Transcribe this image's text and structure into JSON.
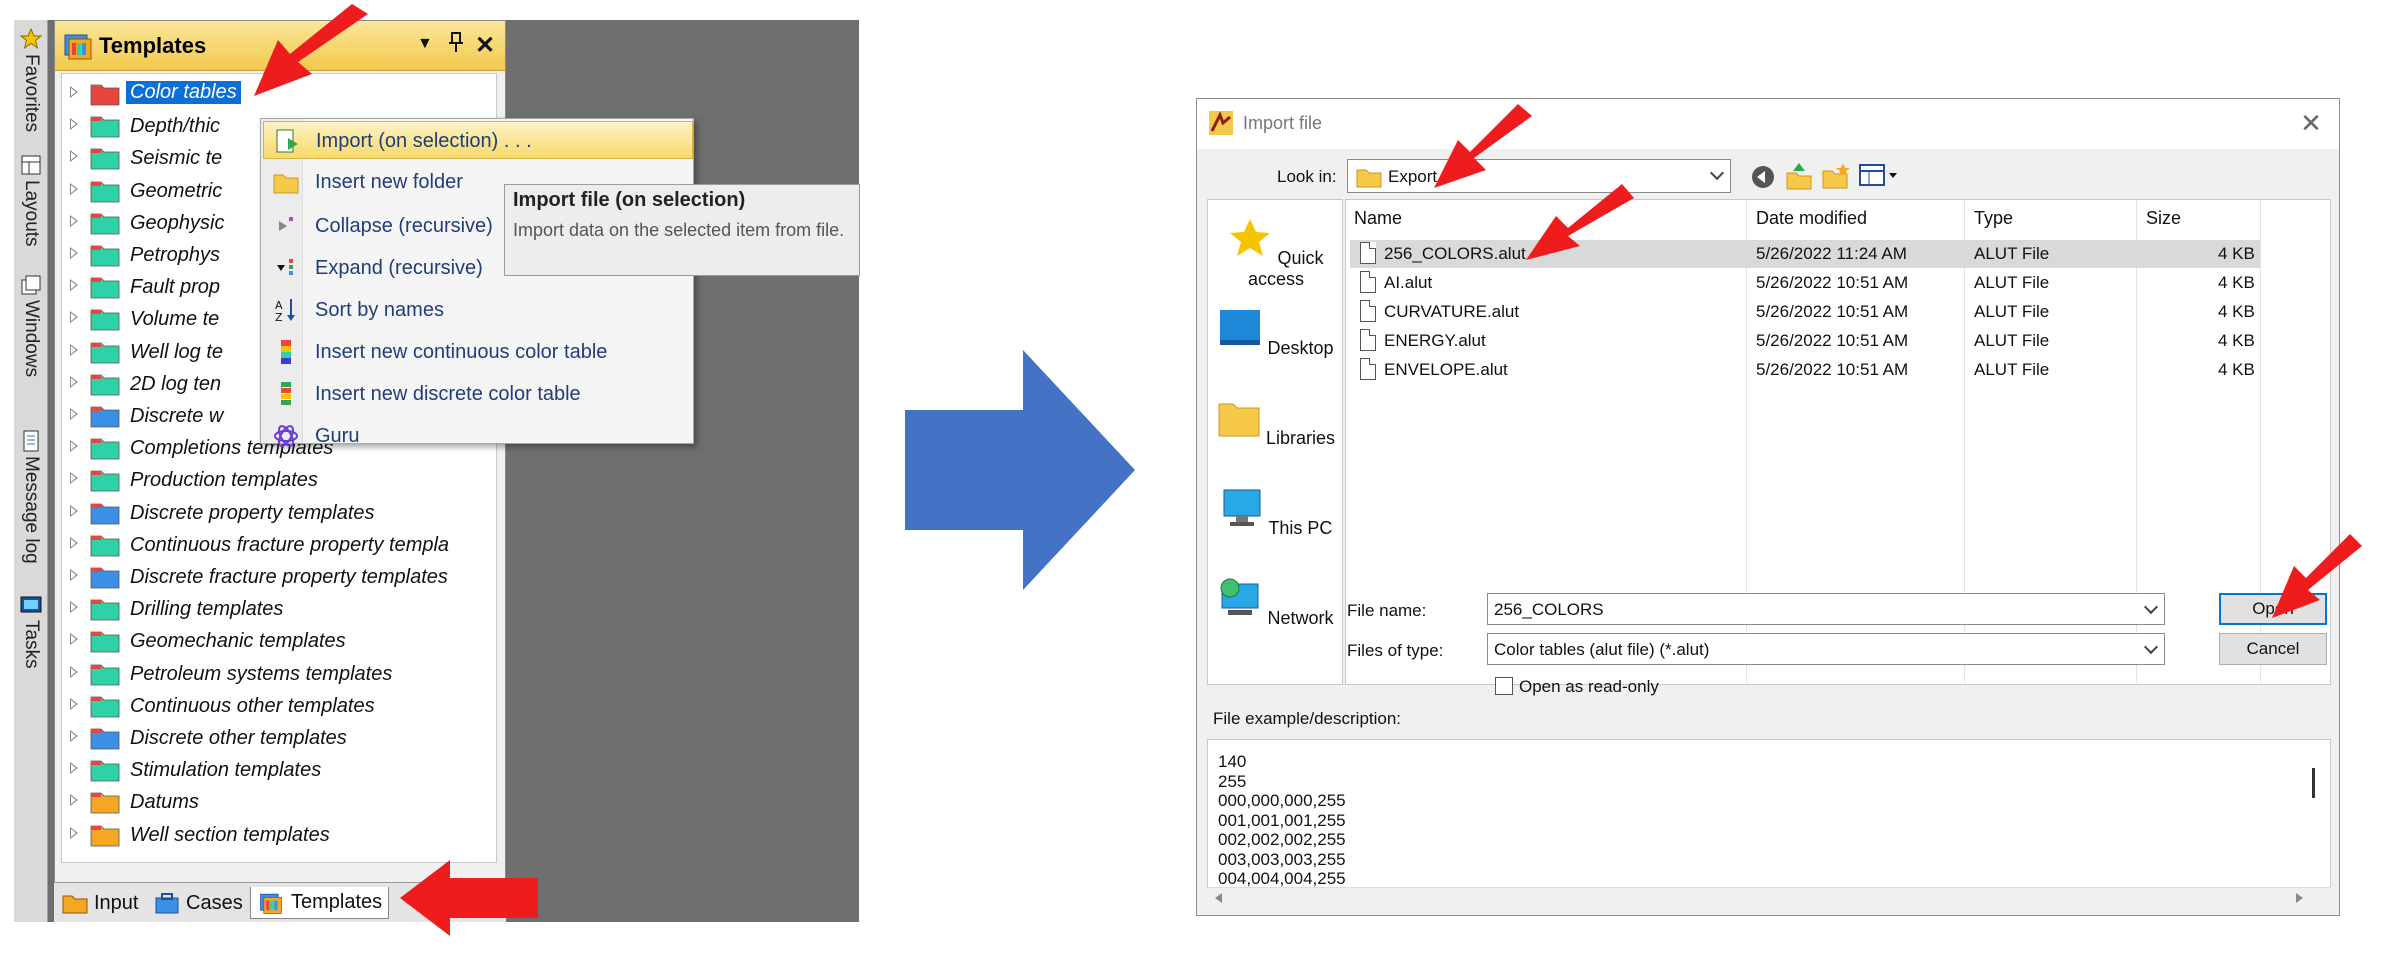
{
  "left_panel": {
    "vertical_tabs": [
      {
        "label": "Favorites",
        "icon": "star-icon"
      },
      {
        "label": "Layouts",
        "icon": "layout-icon"
      },
      {
        "label": "Windows",
        "icon": "windows-icon"
      },
      {
        "label": "Message log",
        "icon": "message-log-icon"
      },
      {
        "label": "Tasks",
        "icon": "tasks-icon"
      }
    ],
    "pane": {
      "title": "Templates",
      "controls": [
        "▼",
        "📌",
        "✕"
      ]
    },
    "tree_items": [
      {
        "label": "Color tables",
        "selected": true,
        "folder_color": "#e8453c"
      },
      {
        "label": "Depth/thic",
        "folder_color": "#2fd1a6"
      },
      {
        "label": "Seismic te",
        "folder_color": "#2fd1a6"
      },
      {
        "label": "Geometric",
        "folder_color": "#2fd1a6"
      },
      {
        "label": "Geophysic",
        "folder_color": "#2fd1a6"
      },
      {
        "label": "Petrophys",
        "folder_color": "#2fd1a6"
      },
      {
        "label": "Fault prop",
        "folder_color": "#2fd1a6"
      },
      {
        "label": "Volume te",
        "folder_color": "#2fd1a6"
      },
      {
        "label": "Well log te",
        "folder_color": "#2fd1a6"
      },
      {
        "label": "2D log ten",
        "folder_color": "#2fd1a6"
      },
      {
        "label": "Discrete w",
        "folder_color": "#3b8fe6"
      },
      {
        "label": "Completions templates",
        "folder_color": "#2fd1a6"
      },
      {
        "label": "Production templates",
        "folder_color": "#2fd1a6"
      },
      {
        "label": "Discrete property templates",
        "folder_color": "#3b8fe6"
      },
      {
        "label": "Continuous fracture property templa",
        "folder_color": "#2fd1a6"
      },
      {
        "label": "Discrete fracture property templates",
        "folder_color": "#3b8fe6"
      },
      {
        "label": "Drilling templates",
        "folder_color": "#2fd1a6"
      },
      {
        "label": "Geomechanic templates",
        "folder_color": "#2fd1a6"
      },
      {
        "label": "Petroleum systems templates",
        "folder_color": "#2fd1a6"
      },
      {
        "label": "Continuous other templates",
        "folder_color": "#2fd1a6"
      },
      {
        "label": "Discrete other templates",
        "folder_color": "#3b8fe6"
      },
      {
        "label": "Stimulation templates",
        "folder_color": "#2fd1a6"
      },
      {
        "label": "Datums",
        "folder_color": "#f5a623"
      },
      {
        "label": "Well section templates",
        "folder_color": "#f5a623"
      }
    ],
    "bottom_tabs": [
      {
        "label": "Input"
      },
      {
        "label": "Cases"
      },
      {
        "label": "Templates",
        "active": true
      }
    ],
    "context_menu": [
      {
        "label": "Import (on selection) . . .",
        "icon": "import-icon",
        "highlighted": true
      },
      {
        "label": "Insert new folder",
        "icon": "new-folder-icon"
      },
      {
        "label": "Collapse (recursive)",
        "icon": "collapse-icon"
      },
      {
        "label": "Expand (recursive)",
        "icon": "expand-icon"
      },
      {
        "label": "Sort by names",
        "icon": "sort-az-icon"
      },
      {
        "label": "Insert new continuous color table",
        "icon": "continuous-color-icon"
      },
      {
        "label": "Insert new discrete color table",
        "icon": "discrete-color-icon"
      },
      {
        "label": "Guru",
        "icon": "guru-icon"
      }
    ],
    "tooltip": {
      "title": "Import file (on selection)",
      "description": "Import data on the selected item from file."
    }
  },
  "dialog": {
    "title": "Import file",
    "close": "✕",
    "look_in_label": "Look in:",
    "look_in_value": "Export",
    "toolbar_icons": [
      "back-icon",
      "up-folder-icon",
      "new-folder-icon",
      "view-menu-icon"
    ],
    "places": [
      {
        "label": "Quick access",
        "icon": "star-icon"
      },
      {
        "label": "Desktop",
        "icon": "desktop-icon"
      },
      {
        "label": "Libraries",
        "icon": "libraries-icon"
      },
      {
        "label": "This PC",
        "icon": "this-pc-icon"
      },
      {
        "label": "Network",
        "icon": "network-icon"
      }
    ],
    "columns": [
      "Name",
      "Date modified",
      "Type",
      "Size"
    ],
    "files": [
      {
        "name": "256_COLORS.alut",
        "date": "5/26/2022 11:24 AM",
        "type": "ALUT File",
        "size": "4 KB",
        "selected": true
      },
      {
        "name": "AI.alut",
        "date": "5/26/2022 10:51 AM",
        "type": "ALUT File",
        "size": "4 KB"
      },
      {
        "name": "CURVATURE.alut",
        "date": "5/26/2022 10:51 AM",
        "type": "ALUT File",
        "size": "4 KB"
      },
      {
        "name": "ENERGY.alut",
        "date": "5/26/2022 10:51 AM",
        "type": "ALUT File",
        "size": "4 KB"
      },
      {
        "name": "ENVELOPE.alut",
        "date": "5/26/2022 10:51 AM",
        "type": "ALUT File",
        "size": "4 KB"
      }
    ],
    "file_name_label": "File name:",
    "file_name_value": "256_COLORS",
    "files_of_type_label": "Files of type:",
    "files_of_type_value": "Color tables (alut file) (*.alut)",
    "read_only_label": "Open as read-only",
    "open_button": "Open",
    "cancel_button": "Cancel",
    "description_label": "File example/description:",
    "description_text": "140\n255\n000,000,000,255\n001,001,001,255\n002,002,002,255\n003,003,003,255\n004,004,004,255"
  },
  "colors": {
    "annotation_red": "#ee1c1c",
    "flow_arrow_blue": "#4472c4",
    "selection_blue": "#0a6fd6",
    "title_gold": "#f2c94c"
  }
}
